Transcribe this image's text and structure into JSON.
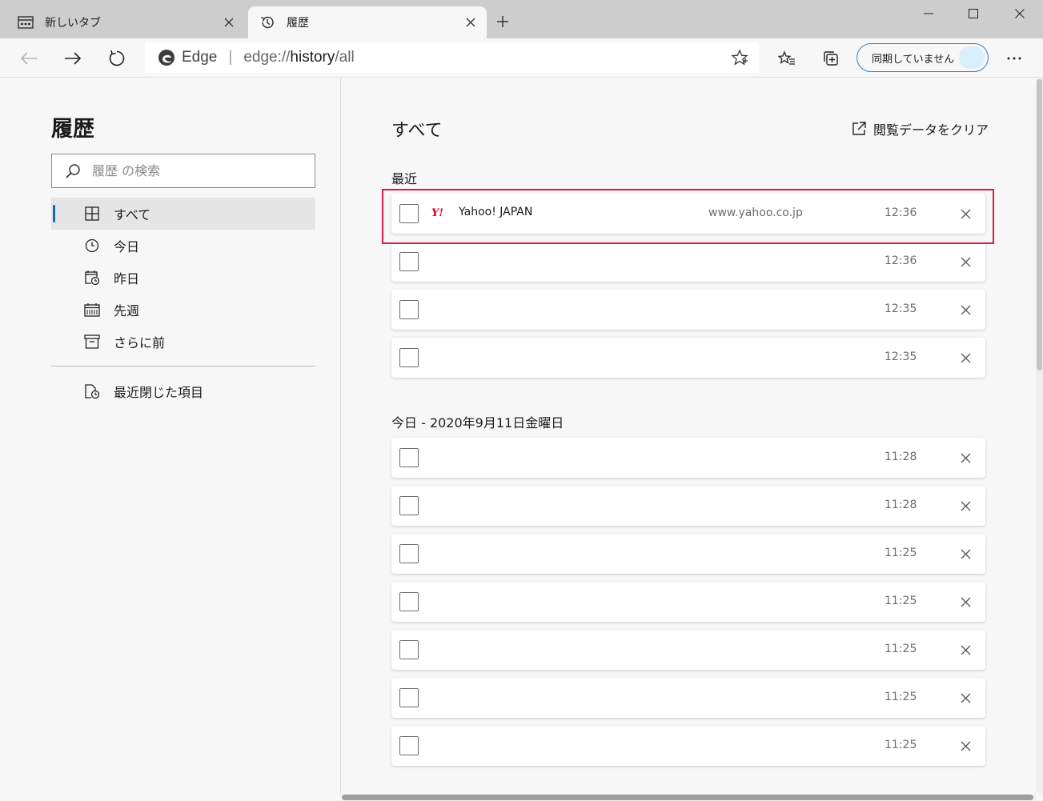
{
  "tabs": [
    {
      "label": "新しいタブ",
      "icon": "new-tab-icon",
      "active": false
    },
    {
      "label": "履歴",
      "icon": "history-icon",
      "active": true
    }
  ],
  "address_bar": {
    "brand": "Edge",
    "url_scheme": "edge://",
    "url_host": "history",
    "url_path": "/all"
  },
  "sync_button": {
    "label": "同期していません"
  },
  "sidebar": {
    "title": "履歴",
    "search_placeholder": "履歴 の検索",
    "nav": [
      {
        "label": "すべて",
        "icon": "grid-icon",
        "selected": true
      },
      {
        "label": "今日",
        "icon": "clock-icon",
        "selected": false
      },
      {
        "label": "昨日",
        "icon": "calendar-yesterday-icon",
        "selected": false
      },
      {
        "label": "先週",
        "icon": "calendar-week-icon",
        "selected": false
      },
      {
        "label": "さらに前",
        "icon": "archive-icon",
        "selected": false
      }
    ],
    "recently_closed": {
      "label": "最近閉じた項目",
      "icon": "recently-closed-icon"
    }
  },
  "main": {
    "title": "すべて",
    "clear_link": "閲覧データをクリア",
    "sections": [
      {
        "label": "最近",
        "rows": [
          {
            "title": "Yahoo! JAPAN",
            "favicon": "Y!",
            "domain": "www.yahoo.co.jp",
            "time": "12:36",
            "highlighted": true
          },
          {
            "title": "",
            "favicon": "",
            "domain": "",
            "time": "12:36"
          },
          {
            "title": "",
            "favicon": "",
            "domain": "",
            "time": "12:35"
          },
          {
            "title": "",
            "favicon": "",
            "domain": "",
            "time": "12:35"
          }
        ]
      },
      {
        "label": "今日 - 2020年9月11日金曜日",
        "rows": [
          {
            "title": "",
            "favicon": "",
            "domain": "",
            "time": "11:28"
          },
          {
            "title": "",
            "favicon": "",
            "domain": "",
            "time": "11:28"
          },
          {
            "title": "",
            "favicon": "",
            "domain": "",
            "time": "11:25"
          },
          {
            "title": "",
            "favicon": "",
            "domain": "",
            "time": "11:25"
          },
          {
            "title": "",
            "favicon": "",
            "domain": "",
            "time": "11:25"
          },
          {
            "title": "",
            "favicon": "",
            "domain": "",
            "time": "11:25"
          },
          {
            "title": "",
            "favicon": "",
            "domain": "",
            "time": "11:25"
          }
        ]
      }
    ]
  },
  "colors": {
    "accent": "#0f6cbd",
    "highlight_border": "#d81b47",
    "yahoo_red": "#d6002a"
  }
}
